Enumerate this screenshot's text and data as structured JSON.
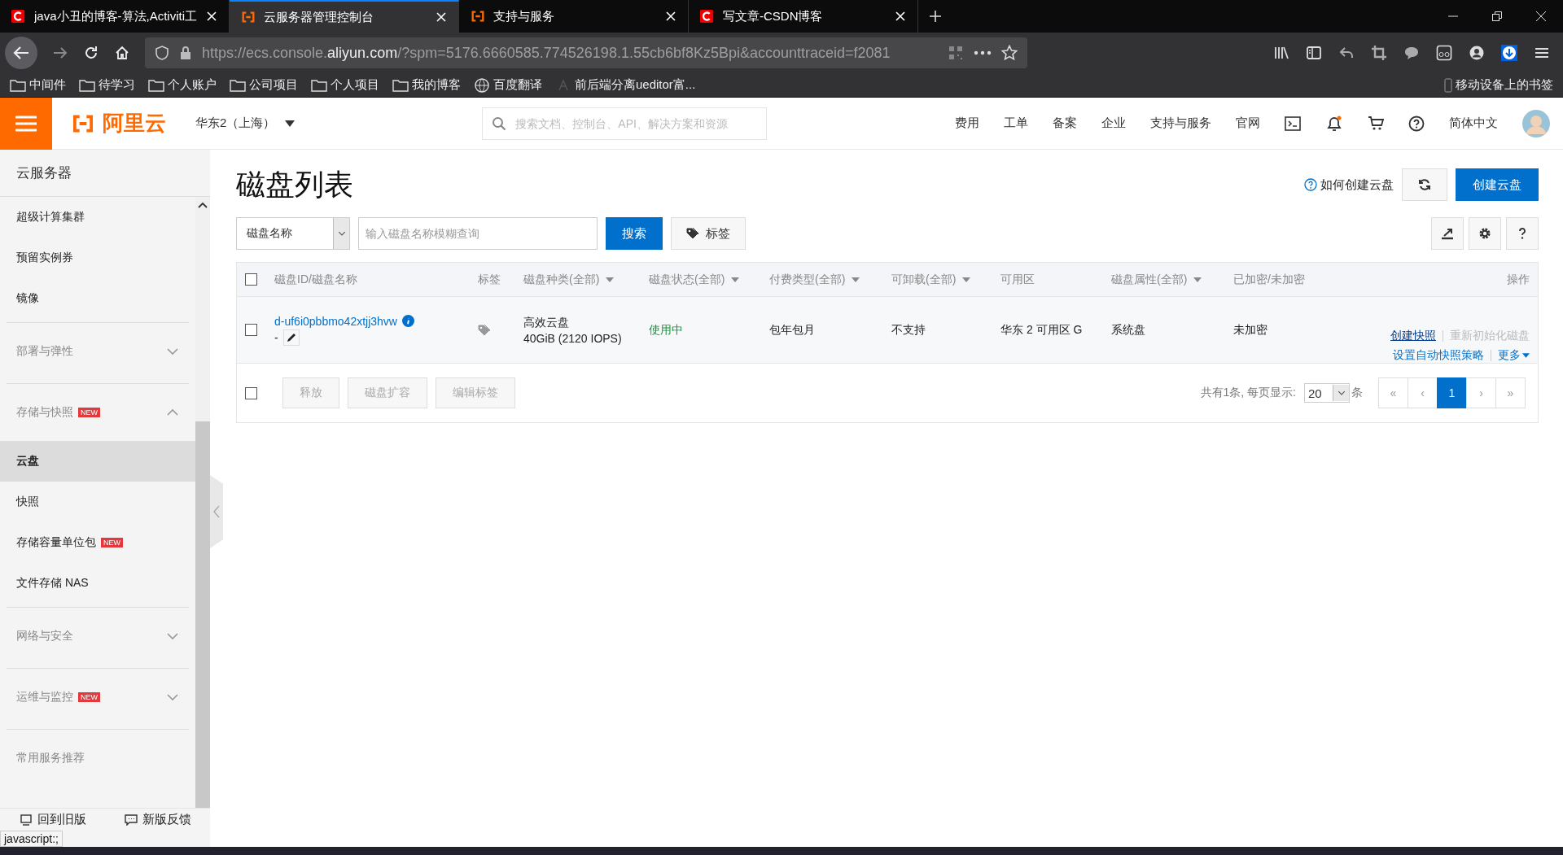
{
  "browser": {
    "tabs": [
      {
        "title": "java小丑的博客-算法,Activiti工",
        "kind": "blog",
        "selected": false
      },
      {
        "title": "云服务器管理控制台",
        "kind": "console",
        "selected": true
      },
      {
        "title": "支持与服务",
        "kind": "console",
        "selected": false
      },
      {
        "title": "写文章-CSDN博客",
        "kind": "blog",
        "selected": false
      }
    ],
    "url": {
      "prefix": "https://ecs.console.",
      "domain": "aliyun.com",
      "rest": "/?spm=5176.6660585.774526198.1.55cb6bf8Kz5Bpi&accounttraceid=f2081"
    },
    "bookmarks": [
      {
        "label": "中间件",
        "kind": "folder"
      },
      {
        "label": "待学习",
        "kind": "folder"
      },
      {
        "label": "个人账户",
        "kind": "folder"
      },
      {
        "label": "公司项目",
        "kind": "folder"
      },
      {
        "label": "个人项目",
        "kind": "folder"
      },
      {
        "label": "我的博客",
        "kind": "folder"
      },
      {
        "label": "百度翻译",
        "kind": "globe"
      },
      {
        "label": "前后端分离ueditor富...",
        "kind": "page"
      }
    ],
    "mobile_bookmarks": "移动设备上的书签"
  },
  "header": {
    "logo": "阿里云",
    "region": "华东2（上海）",
    "search_placeholder": "搜索文档、控制台、API、解决方案和资源",
    "nav": [
      "费用",
      "工单",
      "备案",
      "企业",
      "支持与服务",
      "官网"
    ],
    "language": "简体中文"
  },
  "sidebar": {
    "title": "云服务器",
    "items": [
      {
        "kind": "link",
        "label": "超级计算集群",
        "selected": false
      },
      {
        "kind": "link",
        "label": "预留实例券",
        "selected": false
      },
      {
        "kind": "link",
        "label": "镜像",
        "selected": false
      },
      {
        "kind": "group",
        "label": "部署与弹性",
        "expanded": false
      },
      {
        "kind": "group",
        "label": "存储与快照",
        "badge": "NEW",
        "expanded": true,
        "children": [
          {
            "label": "云盘",
            "selected": true
          },
          {
            "label": "快照",
            "selected": false
          },
          {
            "label": "存储容量单位包",
            "badge": "NEW",
            "selected": false
          },
          {
            "label": "文件存储 NAS",
            "selected": false
          }
        ]
      },
      {
        "kind": "group",
        "label": "网络与安全",
        "expanded": false
      },
      {
        "kind": "group",
        "label": "运维与监控",
        "badge": "NEW",
        "expanded": false
      },
      {
        "kind": "section",
        "label": "常用服务推荐"
      }
    ],
    "footer": [
      "回到旧版",
      "新版反馈"
    ],
    "status_text": "javascript:;"
  },
  "page": {
    "title": "磁盘列表",
    "help_link": "如何创建云盘",
    "create_button": "创建云盘",
    "filter": {
      "select": "磁盘名称",
      "placeholder": "输入磁盘名称模糊查询",
      "search_button": "搜索",
      "tag_button": "标签"
    },
    "table": {
      "columns": [
        {
          "label": "磁盘ID/磁盘名称",
          "filter": false
        },
        {
          "label": "标签",
          "filter": false
        },
        {
          "label": "磁盘种类(全部)",
          "filter": true
        },
        {
          "label": "磁盘状态(全部)",
          "filter": true
        },
        {
          "label": "付费类型(全部)",
          "filter": true
        },
        {
          "label": "可卸载(全部)",
          "filter": true
        },
        {
          "label": "可用区",
          "filter": false
        },
        {
          "label": "磁盘属性(全部)",
          "filter": true
        },
        {
          "label": "已加密/未加密",
          "filter": false
        },
        {
          "label": "操作",
          "filter": false
        }
      ],
      "rows": [
        {
          "selected": false,
          "id": "d-uf6i0pbbmo42xtjj3hvw",
          "name": "-",
          "type": "高效云盘",
          "size": "40GiB (2120 IOPS)",
          "status": "使用中",
          "billing": "包年包月",
          "detachable": "不支持",
          "zone": "华东 2 可用区 G",
          "attribute": "系统盘",
          "encryption": "未加密",
          "actions": [
            {
              "label": "创建快照",
              "disabled": false
            },
            {
              "label": "重新初始化磁盘",
              "disabled": true
            },
            {
              "label": "设置自动快照策略",
              "disabled": false
            },
            {
              "label": "更多",
              "disabled": false,
              "dropdown": true
            }
          ]
        }
      ],
      "select_all": false,
      "bulk_actions": [
        {
          "label": "释放",
          "disabled": true
        },
        {
          "label": "磁盘扩容",
          "disabled": true
        },
        {
          "label": "编辑标签",
          "disabled": true
        }
      ],
      "pagination": {
        "summary": "共有1条, 每页显示:",
        "page_size": "20",
        "unit": "条",
        "pages": [
          {
            "label": "«",
            "selected": false
          },
          {
            "label": "‹",
            "selected": false
          },
          {
            "label": "1",
            "selected": true
          },
          {
            "label": "›",
            "selected": false
          },
          {
            "label": "»",
            "selected": false
          }
        ]
      }
    }
  }
}
